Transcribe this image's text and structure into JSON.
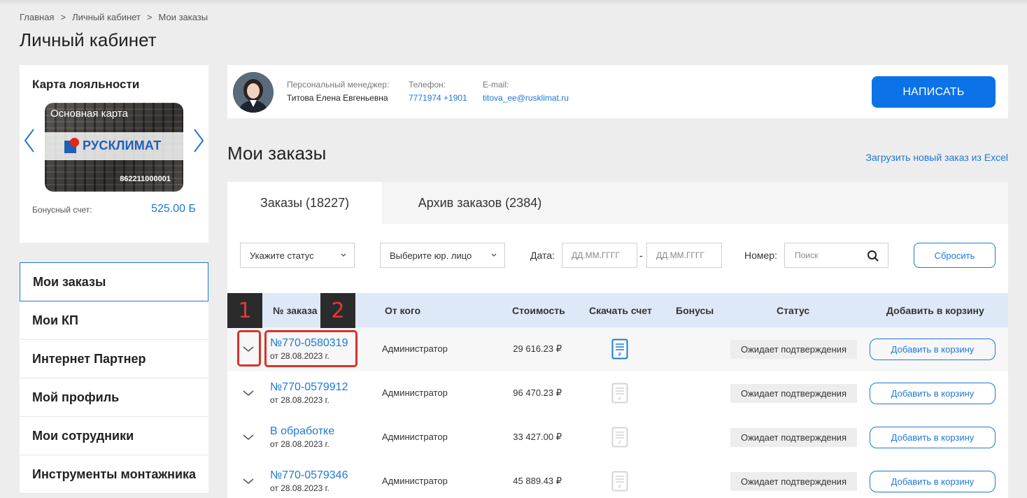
{
  "breadcrumb": [
    "Главная",
    "Личный кабинет",
    "Мои заказы"
  ],
  "page_title": "Личный кабинет",
  "loyalty": {
    "title": "Карта лояльности",
    "card_name": "Основная карта",
    "card_brand": "РУСКЛИМАТ",
    "card_number": "862211000001",
    "bonus_label": "Бонусный счет:",
    "bonus_value": "525.00 Б"
  },
  "menu": [
    "Мои заказы",
    "Мои КП",
    "Интернет Партнер",
    "Мой профиль",
    "Мои сотрудники",
    "Инструменты монтажника"
  ],
  "manager": {
    "role_label": "Персональный менеджер:",
    "name": "Титова Елена Евгеньевна",
    "phone_label": "Телефон:",
    "phone": "7771974 +1901",
    "email_label": "E-mail:",
    "email": "titova_ee@rusklimat.ru",
    "write_button": "НАПИСАТЬ"
  },
  "orders": {
    "title": "Мои заказы",
    "excel_link": "Загрузить новый заказ из Excel",
    "tabs": [
      "Заказы (18227)",
      "Архив заказов (2384)"
    ],
    "filters": {
      "status_placeholder": "Укажите статус",
      "entity_placeholder": "Выберите юр. лицо",
      "date_label": "Дата:",
      "date_from": "ДД.ММ.ГГГГ",
      "date_to": "ДД.ММ.ГГГГ",
      "date_sep": "-",
      "number_label": "Номер:",
      "search_placeholder": "Поиск",
      "reset_button": "Сбросить"
    },
    "columns": [
      "№ заказа",
      "От кого",
      "Стоимость",
      "Скачать счет",
      "Бонусы",
      "Статус",
      "Добавить в корзину"
    ],
    "rows": [
      {
        "number": "№770-0580319",
        "date": "от 28.08.2023 г.",
        "from": "Администратор",
        "price": "29 616.23 ₽",
        "invoice_available": true,
        "status": "Ожидает подтверждения",
        "add": "Добавить в корзину"
      },
      {
        "number": "№770-0579912",
        "date": "от 28.08.2023 г.",
        "from": "Администратор",
        "price": "96 470.23 ₽",
        "invoice_available": false,
        "status": "Ожидает подтверждения",
        "add": "Добавить в корзину"
      },
      {
        "number": "В обработке",
        "date": "от 28.08.2023 г.",
        "from": "Администратор",
        "price": "33 427.00 ₽",
        "invoice_available": false,
        "status": "Ожидает подтверждения",
        "add": "Добавить в корзину"
      },
      {
        "number": "№770-0579346",
        "date": "от 28.08.2023 г.",
        "from": "Администратор",
        "price": "45 889.43 ₽",
        "invoice_available": false,
        "status": "Ожидает подтверждения",
        "add": "Добавить в корзину"
      }
    ]
  },
  "annotations": [
    "1",
    "2"
  ],
  "colors": {
    "accent": "#1e78d6",
    "button": "#0b72e7",
    "annotation": "#d9322c",
    "header_bg": "#dde9f7"
  }
}
